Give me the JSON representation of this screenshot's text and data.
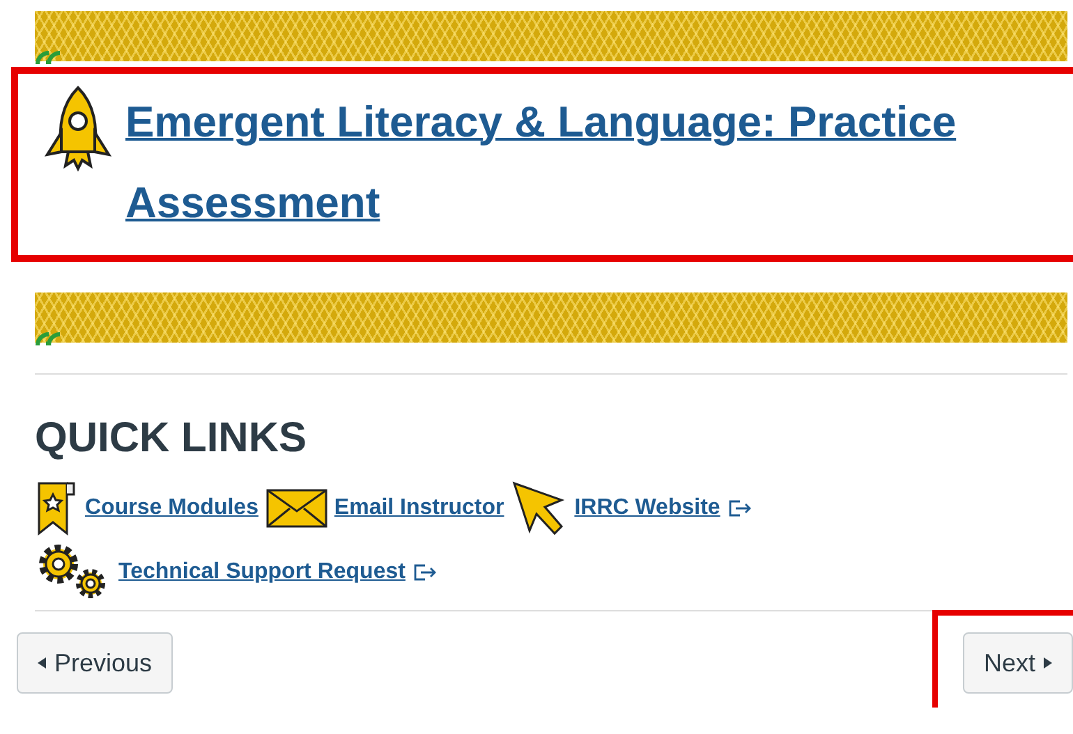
{
  "title": {
    "text": "Emergent Literacy & Language: Practice Assessment",
    "highlighted": true
  },
  "section_heading": "QUICK LINKS",
  "quick_links": [
    {
      "label": "Course Modules",
      "kind": "bookmark",
      "external": false
    },
    {
      "label": "Email Instructor",
      "kind": "envelope",
      "external": false
    },
    {
      "label": "IRRC Website",
      "kind": "cursor",
      "external": true
    },
    {
      "label": "Technical Support Request",
      "kind": "gears",
      "external": true
    }
  ],
  "navigation": [
    {
      "label": "Previous",
      "kind": "previous",
      "highlighted": false
    },
    {
      "label": "Next",
      "kind": "next",
      "highlighted": true
    }
  ]
}
